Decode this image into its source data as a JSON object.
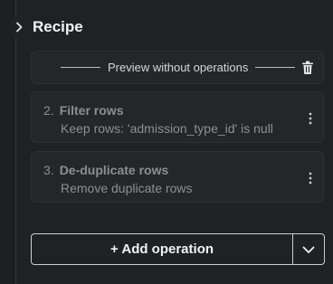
{
  "header": {
    "toggle_icon": "chevron-right-icon",
    "title": "Recipe"
  },
  "preview": {
    "label": "Preview without operations",
    "delete_icon": "trash-icon"
  },
  "operations": [
    {
      "number": "2.",
      "name": "Filter rows",
      "description": "Keep rows: 'admission_type_id' is null",
      "menu_icon": "kebab-menu-icon"
    },
    {
      "number": "3.",
      "name": "De-duplicate rows",
      "description": "Remove duplicate rows",
      "menu_icon": "kebab-menu-icon"
    }
  ],
  "add_operation": {
    "label": "+ Add operation",
    "dropdown_icon": "chevron-down-icon"
  },
  "colors": {
    "background": "#1f2123",
    "card": "#24272a",
    "muted_text": "#8b8f94",
    "border": "#cfcfcf"
  }
}
